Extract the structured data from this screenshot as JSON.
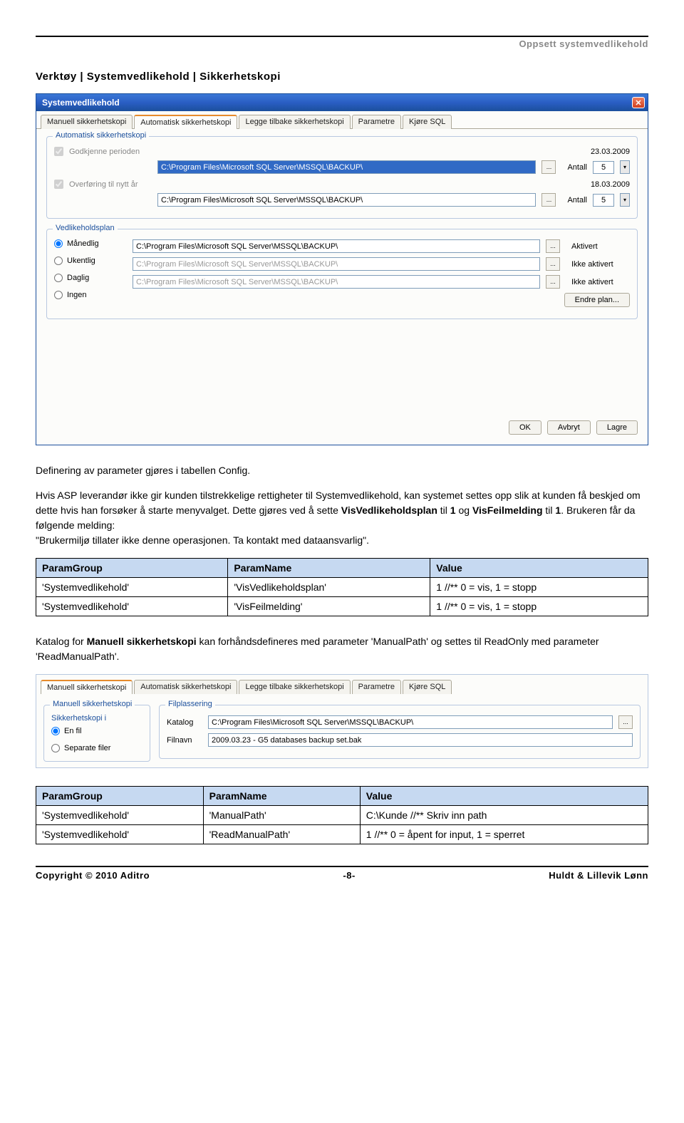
{
  "header": "Oppsett systemvedlikehold",
  "breadcrumb": "Verktøy | Systemvedlikehold | Sikkerhetskopi",
  "window": {
    "title": "Systemvedlikehold",
    "tabs": [
      "Manuell sikkerhetskopi",
      "Automatisk sikkerhetskopi",
      "Legge tilbake sikkerhetskopi",
      "Parametre",
      "Kjøre SQL"
    ],
    "active_tab": 1,
    "auto": {
      "legend": "Automatisk sikkerhetskopi",
      "chk1_label": "Godkjenne perioden",
      "path1": "C:\\Program Files\\Microsoft SQL Server\\MSSQL\\BACKUP\\",
      "date1": "23.03.2009",
      "antall_label": "Antall",
      "antall1": "5",
      "chk2_label": "Overføring til nytt år",
      "path2": "C:\\Program Files\\Microsoft SQL Server\\MSSQL\\BACKUP\\",
      "date2": "18.03.2009",
      "antall2": "5"
    },
    "plan": {
      "legend": "Vedlikeholdsplan",
      "r1": "Månedlig",
      "r2": "Ukentlig",
      "r3": "Daglig",
      "r4": "Ingen",
      "path1": "C:\\Program Files\\Microsoft SQL Server\\MSSQL\\BACKUP\\",
      "path2": "C:\\Program Files\\Microsoft SQL Server\\MSSQL\\BACKUP\\",
      "path3": "C:\\Program Files\\Microsoft SQL Server\\MSSQL\\BACKUP\\",
      "s1": "Aktivert",
      "s2": "Ikke aktivert",
      "s3": "Ikke aktivert",
      "endre": "Endre plan..."
    },
    "btns": {
      "ok": "OK",
      "avbryt": "Avbryt",
      "lagre": "Lagre"
    }
  },
  "para1": "Definering av parameter gjøres i tabellen Config.",
  "para2a": "Hvis ASP leverandør ikke gir kunden tilstrekkelige rettigheter til Systemvedlikehold, kan systemet settes opp slik at kunden få beskjed om dette hvis han forsøker å starte menyvalget. Dette gjøres ved å sette ",
  "para2b": "VisVedlikeholdsplan",
  "para2c": " til ",
  "para2d": "1",
  "para2e": " og ",
  "para2f": "VisFeilmelding",
  "para2g": " til ",
  "para2h": "1",
  "para2i": ". Brukeren får da følgende melding:",
  "para2j": "\"Brukermiljø tillater ikke denne operasjonen. Ta kontakt med dataansvarlig\".",
  "table1": {
    "h1": "ParamGroup",
    "h2": "ParamName",
    "h3": "Value",
    "r1c1": "'Systemvedlikehold'",
    "r1c2": "'VisVedlikeholdsplan'",
    "r1c3": "1 //** 0 = vis, 1 = stopp",
    "r2c1": "'Systemvedlikehold'",
    "r2c2": "'VisFeilmelding'",
    "r2c3": "1 //** 0 = vis, 1 = stopp"
  },
  "para3a": "Katalog for ",
  "para3b": "Manuell sikkerhetskopi",
  "para3c": " kan forhåndsdefineres med parameter 'ManualPath' og settes til ReadOnly med parameter 'ReadManualPath'.",
  "win2": {
    "left_legend": "Manuell sikkerhetskopi",
    "sub_legend": "Sikkerhetskopi i",
    "r1": "En fil",
    "r2": "Separate filer",
    "right_legend": "Filplassering",
    "katalog_lbl": "Katalog",
    "katalog_val": "C:\\Program Files\\Microsoft SQL Server\\MSSQL\\BACKUP\\",
    "filnavn_lbl": "Filnavn",
    "filnavn_val": "2009.03.23 - G5 databases backup set.bak"
  },
  "table2": {
    "h1": "ParamGroup",
    "h2": "ParamName",
    "h3": "Value",
    "r1c1": "'Systemvedlikehold'",
    "r1c2": "'ManualPath'",
    "r1c3": "C:\\Kunde //** Skriv inn path",
    "r2c1": "'Systemvedlikehold'",
    "r2c2": "'ReadManualPath'",
    "r2c3": "1 //** 0 = åpent for input, 1 = sperret"
  },
  "footer": {
    "left": "Copyright © 2010 Aditro",
    "center": "-8-",
    "right": "Huldt & Lillevik Lønn"
  }
}
